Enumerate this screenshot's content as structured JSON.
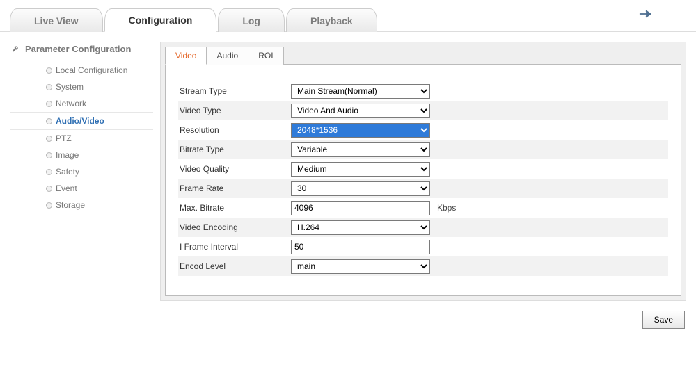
{
  "nav": {
    "liveview": "Live View",
    "configuration": "Configuration",
    "log": "Log",
    "playback": "Playback"
  },
  "sidebar": {
    "title": "Parameter Configuration",
    "items": [
      "Local Configuration",
      "System",
      "Network",
      "Audio/Video",
      "PTZ",
      "Image",
      "Safety",
      "Event",
      "Storage"
    ]
  },
  "subtabs": {
    "video": "Video",
    "audio": "Audio",
    "roi": "ROI"
  },
  "form": {
    "stream_type_label": "Stream Type",
    "stream_type_value": "Main Stream(Normal)",
    "video_type_label": "Video Type",
    "video_type_value": "Video And Audio",
    "resolution_label": "Resolution",
    "resolution_value": "2048*1536",
    "bitrate_type_label": "Bitrate Type",
    "bitrate_type_value": "Variable",
    "video_quality_label": "Video Quality",
    "video_quality_value": "Medium",
    "frame_rate_label": "Frame Rate",
    "frame_rate_value": "30",
    "max_bitrate_label": "Max. Bitrate",
    "max_bitrate_value": "4096",
    "max_bitrate_unit": "Kbps",
    "video_encoding_label": "Video Encoding",
    "video_encoding_value": "H.264",
    "iframe_label": "I Frame Interval",
    "iframe_value": "50",
    "encod_level_label": "Encod Level",
    "encod_level_value": "main"
  },
  "buttons": {
    "save": "Save"
  }
}
